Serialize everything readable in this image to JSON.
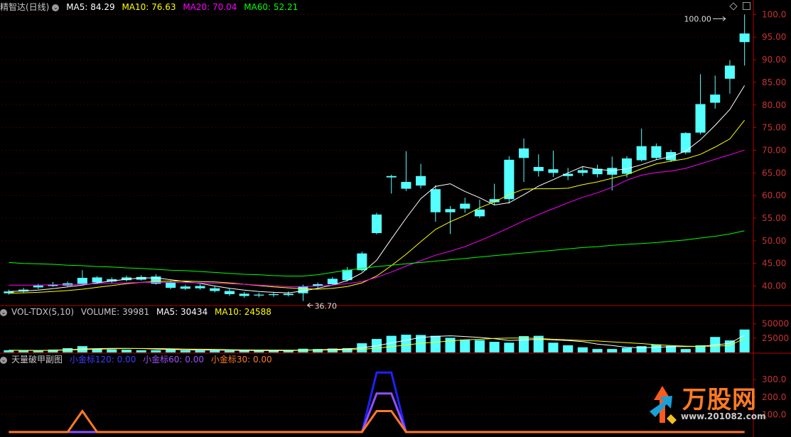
{
  "main_header": {
    "stock": "精智达(日线)",
    "ma5": "MA5: 84.29",
    "ma10": "MA10: 76.63",
    "ma20": "MA20: 70.04",
    "ma60": "MA60: 52.21"
  },
  "vol_header": {
    "name": "VOL-TDX(5,10)",
    "volume": "VOLUME: 39981",
    "ma5": "MA5: 30434",
    "ma10": "MA10: 24588"
  },
  "ind_header": {
    "name": "天量破甲副图",
    "s1": "小金标120: 0.00",
    "s2": "小金标60: 0.00",
    "s3": "小金标30: 0.00"
  },
  "watermark": {
    "title": "万股网",
    "url": "www.201082.com"
  },
  "colors": {
    "up": "#ff3232",
    "down": "#54ffff",
    "ma5": "#ffffff",
    "ma10": "#ffff00",
    "ma20": "#ff00ff",
    "ma60": "#00ff00",
    "axis": "#b40000"
  },
  "chart_data": [
    {
      "type": "candlestick",
      "name": "price",
      "ylim": [
        36,
        101
      ],
      "yticks": [
        40,
        45,
        50,
        55,
        60,
        65,
        70,
        75,
        80,
        85,
        90,
        95,
        100
      ],
      "ytick_labels": [
        "40.00",
        "45.00",
        "50.00",
        "55.00",
        "60.00",
        "65.00",
        "70.00",
        "75.00",
        "80.00",
        "85.00",
        "90.00",
        "95.00",
        "100.0"
      ],
      "annotations": [
        {
          "label": "36.70",
          "index": 20,
          "value": 36.7
        },
        {
          "label": "100.00",
          "index": 49,
          "value": 100.0
        }
      ],
      "candles": [
        [
          38.8,
          38.4,
          39.2,
          38.1
        ],
        [
          39.2,
          38.8,
          39.6,
          38.5
        ],
        [
          40.1,
          39.7,
          40.5,
          39.3
        ],
        [
          40.3,
          40.0,
          40.9,
          39.8
        ],
        [
          40.6,
          40.1,
          41.0,
          39.9
        ],
        [
          41.8,
          40.5,
          43.5,
          40.3
        ],
        [
          41.9,
          40.8,
          42.2,
          40.5
        ],
        [
          41.5,
          41.0,
          41.9,
          40.7
        ],
        [
          41.9,
          41.3,
          42.3,
          41.0
        ],
        [
          42.0,
          41.4,
          42.4,
          41.2
        ],
        [
          42.1,
          40.5,
          42.6,
          40.3
        ],
        [
          40.8,
          39.6,
          41.2,
          39.3
        ],
        [
          39.9,
          39.4,
          40.3,
          39.1
        ],
        [
          40.0,
          39.5,
          40.4,
          39.2
        ],
        [
          39.5,
          38.9,
          39.9,
          38.6
        ],
        [
          38.9,
          38.2,
          39.4,
          37.8
        ],
        [
          38.3,
          37.8,
          38.7,
          37.4
        ],
        [
          38.1,
          37.9,
          38.5,
          37.5
        ],
        [
          38.2,
          38.0,
          38.7,
          37.6
        ],
        [
          38.3,
          38.0,
          38.8,
          37.7
        ],
        [
          39.9,
          38.4,
          40.3,
          36.7
        ],
        [
          40.4,
          40.0,
          40.8,
          39.6
        ],
        [
          41.6,
          40.4,
          42.0,
          40.1
        ],
        [
          43.6,
          41.3,
          44.2,
          41.0
        ],
        [
          47.2,
          43.5,
          47.6,
          43.2
        ],
        [
          55.8,
          51.7,
          56.2,
          51.4
        ],
        [
          64.3,
          64.0,
          64.6,
          60.4
        ],
        [
          63.0,
          61.5,
          69.8,
          61.0
        ],
        [
          64.3,
          62.2,
          67.0,
          61.6
        ],
        [
          61.4,
          56.3,
          62.3,
          54.2
        ],
        [
          57.0,
          56.3,
          57.7,
          51.5
        ],
        [
          58.2,
          57.1,
          59.5,
          56.2
        ],
        [
          56.9,
          55.4,
          59.1,
          55.0
        ],
        [
          59.2,
          58.5,
          62.6,
          57.9
        ],
        [
          67.9,
          59.2,
          68.7,
          58.2
        ],
        [
          70.4,
          68.3,
          72.6,
          63.0
        ],
        [
          66.3,
          65.4,
          69.1,
          64.2
        ],
        [
          65.8,
          65.0,
          69.9,
          64.1
        ],
        [
          64.8,
          64.3,
          66.1,
          63.4
        ],
        [
          65.6,
          65.0,
          66.4,
          64.3
        ],
        [
          65.9,
          64.7,
          66.8,
          64.0
        ],
        [
          66.1,
          64.6,
          68.6,
          61.1
        ],
        [
          68.2,
          64.8,
          68.7,
          64.0
        ],
        [
          70.9,
          67.8,
          74.8,
          67.5
        ],
        [
          70.9,
          68.3,
          71.5,
          67.9
        ],
        [
          69.6,
          67.8,
          70.1,
          67.4
        ],
        [
          73.8,
          69.5,
          74.0,
          69.1
        ],
        [
          80.2,
          73.9,
          86.8,
          73.5
        ],
        [
          82.3,
          80.5,
          86.5,
          79.2
        ],
        [
          88.7,
          85.8,
          89.9,
          82.5
        ],
        [
          95.8,
          93.9,
          100.0,
          88.7
        ]
      ],
      "ma_series": [
        {
          "name": "MA5",
          "values": [
            38.8,
            38.9,
            39.1,
            39.4,
            39.8,
            40.2,
            40.7,
            41.1,
            41.5,
            41.8,
            41.8,
            41.4,
            41.0,
            40.6,
            40.0,
            39.5,
            39.1,
            38.8,
            38.6,
            38.5,
            38.9,
            39.5,
            40.2,
            41.2,
            42.9,
            45.7,
            50.4,
            55.0,
            59.3,
            62.0,
            62.6,
            60.9,
            59.5,
            57.9,
            58.4,
            60.2,
            62.1,
            63.5,
            65.0,
            66.4,
            65.8,
            65.5,
            65.9,
            66.8,
            67.9,
            68.6,
            69.8,
            72.3,
            75.5,
            79.0,
            84.29
          ]
        },
        {
          "name": "MA10",
          "values": [
            38.4,
            38.5,
            38.6,
            38.8,
            39.0,
            39.3,
            39.7,
            40.1,
            40.5,
            40.8,
            41.0,
            41.1,
            41.1,
            41.0,
            40.9,
            40.7,
            40.4,
            40.1,
            39.8,
            39.6,
            39.4,
            39.3,
            39.5,
            39.9,
            40.7,
            42.2,
            44.5,
            47.0,
            49.8,
            52.5,
            54.2,
            55.6,
            57.3,
            58.6,
            60.2,
            61.4,
            61.5,
            61.5,
            61.6,
            62.4,
            63.0,
            63.8,
            64.6,
            65.9,
            67.0,
            67.6,
            68.1,
            69.1,
            70.7,
            72.5,
            76.63
          ]
        },
        {
          "name": "MA20",
          "values": [
            40.2,
            40.2,
            40.2,
            40.3,
            40.3,
            40.4,
            40.5,
            40.6,
            40.7,
            40.8,
            40.8,
            40.8,
            40.8,
            40.7,
            40.6,
            40.5,
            40.4,
            40.2,
            40.0,
            39.9,
            39.9,
            40.0,
            40.2,
            40.5,
            41.0,
            41.9,
            43.1,
            44.4,
            45.6,
            46.8,
            47.7,
            48.7,
            50.0,
            51.4,
            52.9,
            54.4,
            55.8,
            57.1,
            58.4,
            59.6,
            60.6,
            61.8,
            63.4,
            64.5,
            65.1,
            65.4,
            66.0,
            67.0,
            68.0,
            69.0,
            70.04
          ]
        },
        {
          "name": "MA60",
          "values": [
            45.2,
            45.0,
            44.9,
            44.8,
            44.6,
            44.5,
            44.3,
            44.2,
            44.0,
            43.9,
            43.7,
            43.5,
            43.4,
            43.2,
            43.0,
            42.8,
            42.6,
            42.5,
            42.3,
            42.2,
            42.2,
            42.5,
            43.0,
            43.5,
            43.9,
            44.3,
            44.6,
            44.9,
            45.2,
            45.5,
            45.8,
            46.1,
            46.4,
            46.7,
            47.0,
            47.3,
            47.6,
            47.9,
            48.2,
            48.5,
            48.7,
            49.0,
            49.2,
            49.4,
            49.6,
            49.9,
            50.2,
            50.6,
            51.0,
            51.5,
            52.21
          ]
        }
      ]
    },
    {
      "type": "bar",
      "name": "volume",
      "ylim": [
        0,
        62000
      ],
      "yticks": [
        25000,
        50000
      ],
      "ytick_labels": [
        "25000",
        "50000"
      ],
      "values": [
        3800,
        3500,
        3000,
        5000,
        7500,
        11000,
        6800,
        5200,
        4800,
        3800,
        4000,
        5500,
        3600,
        3500,
        3700,
        3000,
        3300,
        2800,
        3000,
        3500,
        6500,
        6000,
        6800,
        7500,
        16000,
        23500,
        29000,
        31000,
        30500,
        29000,
        25500,
        22500,
        21500,
        18500,
        17000,
        28500,
        29000,
        17000,
        12500,
        9000,
        6000,
        6000,
        8000,
        11000,
        14000,
        11500,
        6000,
        12500,
        27000,
        21000,
        39981
      ],
      "ma_series": [
        {
          "name": "MA5",
          "values": [
            3800,
            3700,
            3500,
            3800,
            4600,
            6000,
            6700,
            7100,
            7100,
            6800,
            5900,
            5200,
            4700,
            4200,
            4000,
            3900,
            3600,
            3300,
            3200,
            3200,
            3800,
            4600,
            5400,
            6000,
            8200,
            11700,
            16600,
            21400,
            26000,
            28000,
            29000,
            27800,
            26200,
            24000,
            21000,
            21700,
            23000,
            22000,
            20800,
            19000,
            14500,
            12000,
            9000,
            8000,
            9000,
            10000,
            10200,
            10500,
            13200,
            15900,
            30434
          ]
        },
        {
          "name": "MA10",
          "values": [
            3800,
            3700,
            3500,
            3700,
            4200,
            5000,
            5700,
            6300,
            6800,
            7000,
            6800,
            6400,
            6000,
            5700,
            5400,
            4800,
            4500,
            4300,
            4200,
            4000,
            4100,
            4200,
            4300,
            4700,
            5600,
            7500,
            10000,
            13000,
            16000,
            18000,
            20000,
            22000,
            23000,
            24500,
            25000,
            25000,
            24500,
            23000,
            22000,
            21000,
            20000,
            18500,
            17000,
            15500,
            13500,
            12000,
            11000,
            10500,
            11000,
            12000,
            24588
          ]
        }
      ]
    },
    {
      "type": "line",
      "name": "indicator",
      "ylim": [
        0,
        390
      ],
      "yticks": [
        100,
        200,
        300
      ],
      "ytick_labels": [
        "100.0",
        "200.0",
        "300.0"
      ],
      "series": [
        {
          "name": "小金标120",
          "values": [
            0,
            0,
            0,
            0,
            0,
            0,
            0,
            0,
            0,
            0,
            0,
            0,
            0,
            0,
            0,
            0,
            0,
            0,
            0,
            0,
            0,
            0,
            0,
            0,
            0,
            340,
            340,
            0,
            0,
            0,
            0,
            0,
            0,
            0,
            0,
            0,
            0,
            0,
            0,
            0,
            0,
            0,
            0,
            0,
            0,
            0,
            0,
            0,
            0,
            0,
            0
          ]
        },
        {
          "name": "小金标60",
          "values": [
            0,
            0,
            0,
            0,
            0,
            0,
            0,
            0,
            0,
            0,
            0,
            0,
            0,
            0,
            0,
            0,
            0,
            0,
            0,
            0,
            0,
            0,
            0,
            0,
            0,
            220,
            220,
            0,
            0,
            0,
            0,
            0,
            0,
            0,
            0,
            0,
            0,
            0,
            0,
            0,
            0,
            0,
            0,
            0,
            0,
            0,
            0,
            0,
            0,
            0,
            0
          ]
        },
        {
          "name": "小金标30",
          "values": [
            0,
            0,
            0,
            0,
            0,
            120,
            0,
            0,
            0,
            0,
            0,
            0,
            0,
            0,
            0,
            0,
            0,
            0,
            0,
            0,
            0,
            0,
            0,
            0,
            0,
            120,
            120,
            0,
            0,
            0,
            0,
            0,
            0,
            0,
            0,
            0,
            0,
            0,
            0,
            0,
            0,
            0,
            0,
            0,
            0,
            0,
            0,
            0,
            0,
            0,
            0
          ]
        }
      ]
    }
  ]
}
